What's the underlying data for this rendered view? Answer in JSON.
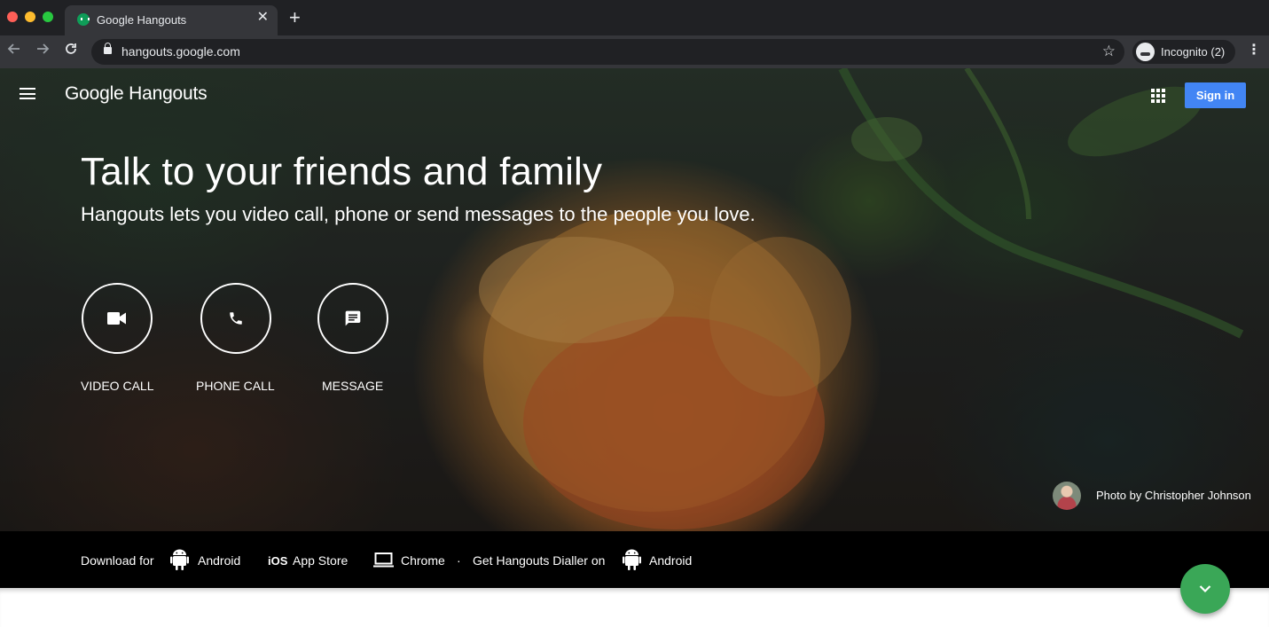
{
  "browser": {
    "tab_title": "Google Hangouts",
    "tab_close": "✕",
    "new_tab": "+",
    "url": "hangouts.google.com",
    "profile_label": "Incognito (2)",
    "icons": [
      "back-arrow-icon",
      "forward-arrow-icon",
      "reload-icon",
      "lock-icon",
      "star-icon",
      "incognito-icon",
      "more-vert-icon"
    ]
  },
  "header": {
    "logo": "Google Hangouts",
    "signin_label": "Sign in",
    "signin_color": "#4285f4"
  },
  "hero": {
    "headline": "Talk to your friends and family",
    "subhead": "Hangouts lets you video call, phone or send messages to the people you love.",
    "actions": [
      {
        "label": "VIDEO CALL",
        "icon": "videocam-icon"
      },
      {
        "label": "PHONE CALL",
        "icon": "phone-icon"
      },
      {
        "label": "MESSAGE",
        "icon": "message-icon"
      }
    ],
    "photo_credit": "Photo by Christopher Johnson"
  },
  "download": {
    "prefix": "Download for",
    "android_1": "Android",
    "ios": "App Store",
    "chrome": "Chrome",
    "separator": "·",
    "dialler": "Get Hangouts Dialler on",
    "android_2": "Android",
    "ios_badge": "iOS"
  },
  "fab": {
    "icon": "chevron-down-icon",
    "color": "#3aa757"
  }
}
